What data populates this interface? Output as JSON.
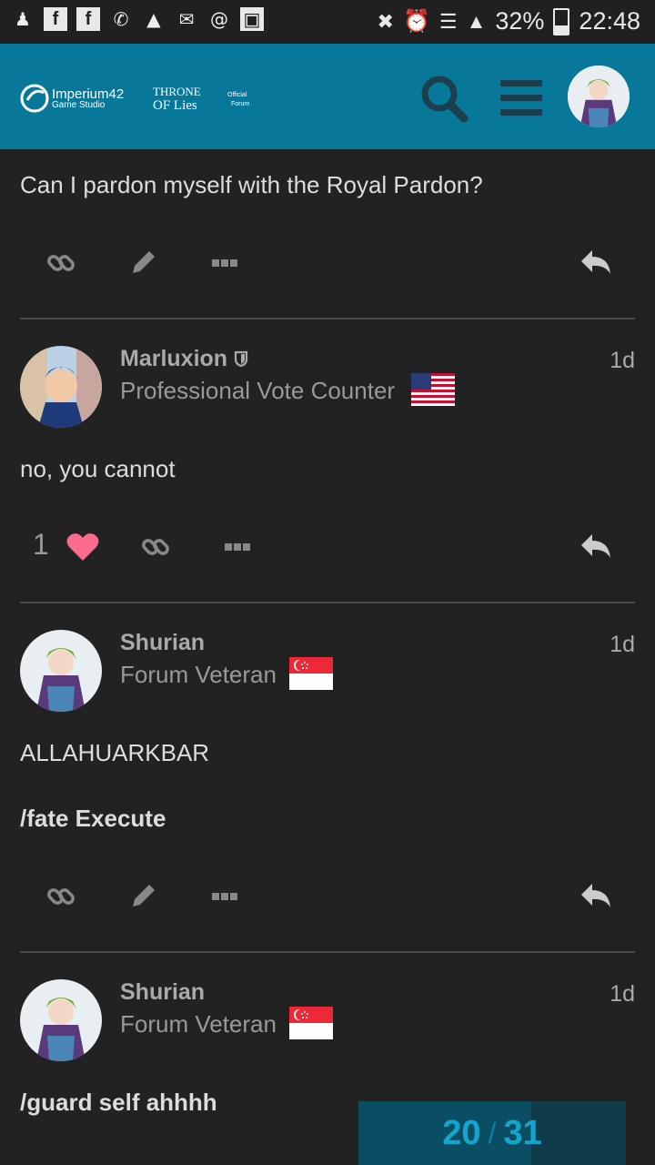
{
  "status_bar": {
    "battery_percent": "32%",
    "time": "22:48"
  },
  "header": {
    "logo_studio": "Imperium42",
    "logo_studio_sub": "Game Studio",
    "logo_game_line1": "Throne",
    "logo_game_line2": "of Lies",
    "logo_official_line1": "Official",
    "logo_official_line2": "Forum"
  },
  "posts": [
    {
      "text": "Can I pardon myself with the Royal Pardon?"
    },
    {
      "username": "Marluxion",
      "title": "Professional Vote Counter",
      "age": "1d",
      "flag": "us",
      "text": "no, you cannot",
      "likes": "1"
    },
    {
      "username": "Shurian",
      "title": "Forum Veteran",
      "age": "1d",
      "flag": "sg",
      "text_line1": "ALLAHUARKBAR",
      "text_line2": "/fate Execute"
    },
    {
      "username": "Shurian",
      "title": "Forum Veteran",
      "age": "1d",
      "flag": "sg",
      "text": "/guard self ahhhh"
    }
  ],
  "progress": {
    "current": "20",
    "separator": "/",
    "total": "31",
    "fraction": 0.645
  },
  "colors": {
    "header": "#08789a",
    "background": "#222222",
    "accent": "#12a6cf",
    "like": "#fa6c8d"
  }
}
